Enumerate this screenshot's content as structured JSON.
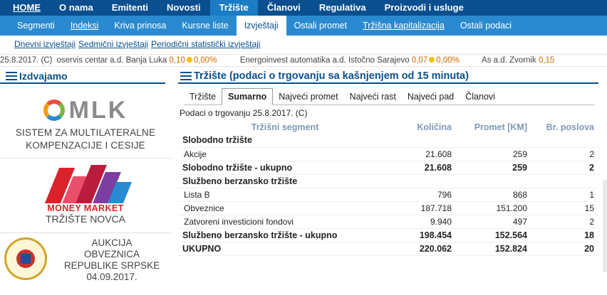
{
  "nav_main": [
    "HOME",
    "O nama",
    "Emitenti",
    "Novosti",
    "Tržište",
    "Članovi",
    "Regulativa",
    "Proizvodi i usluge"
  ],
  "nav_sub": [
    "Segmenti",
    "Indeksi",
    "Kriva prinosa",
    "Kursne liste",
    "Izvještaji",
    "Ostali promet",
    "Tržišna kapitalizacija",
    "Ostali podaci"
  ],
  "nav_reports": [
    "Dnevni izvještaji",
    "Sedmični izvještaji",
    "Periodični statistički izvještaji"
  ],
  "ticker": {
    "date": "25.8.2017. (C)",
    "items": [
      {
        "name": "oservis centar a.d. Banja Luka",
        "price": "0,10",
        "change": "0,00%"
      },
      {
        "name": "Energoinvest automatika a.d. Istočno Sarajevo",
        "price": "0,07",
        "change": "0,00%"
      },
      {
        "name": "As a.d. Zvornik",
        "price": "0,15",
        "change": ""
      }
    ]
  },
  "sidebar": {
    "title": "Izdvajamo",
    "mlk": {
      "logo": "MLK",
      "line1": "SISTEM ZA MULTILATERALNE",
      "line2": "KOMPENZACIJE I CESIJE"
    },
    "money_market": {
      "brand": "MONEY MARKET",
      "sub": "TRŽIŠTE NOVCA"
    },
    "auction": {
      "line1": "AUKCIJA",
      "line2": "OBVEZNICA",
      "line3": "REPUBLIKE SRPSKE",
      "line4": "04.09.2017."
    }
  },
  "main": {
    "title": "Tržište (podaci o trgovanju sa kašnjenjem od 15 minuta)",
    "tabs": [
      "Tržište",
      "Sumarno",
      "Najveći promet",
      "Najveći rast",
      "Najveći pad",
      "Članovi"
    ],
    "active_tab": "Sumarno",
    "caption": "Podaci o trgovanju 25.8.2017. (C)",
    "columns": [
      "Tržišni segment",
      "Količina",
      "Promet [KM]",
      "Br. poslova"
    ],
    "rows": [
      {
        "type": "section",
        "label": "Slobodno tržište"
      },
      {
        "type": "row",
        "label": "Akcije",
        "kolicina": "21.608",
        "promet": "259",
        "poslova": "2"
      },
      {
        "type": "total",
        "label": "Slobodno tržište - ukupno",
        "kolicina": "21.608",
        "promet": "259",
        "poslova": "2"
      },
      {
        "type": "section",
        "label": "Službeno berzansko tržište"
      },
      {
        "type": "row",
        "label": "Lista B",
        "kolicina": "796",
        "promet": "868",
        "poslova": "1"
      },
      {
        "type": "row",
        "label": "Obveznice",
        "kolicina": "187.718",
        "promet": "151.200",
        "poslova": "15"
      },
      {
        "type": "row",
        "label": "Zatvoreni investicioni fondovi",
        "kolicina": "9.940",
        "promet": "497",
        "poslova": "2"
      },
      {
        "type": "total",
        "label": "Službeno berzansko tržište - ukupno",
        "kolicina": "198.454",
        "promet": "152.564",
        "poslova": "18"
      },
      {
        "type": "total",
        "label": "UKUPNO",
        "kolicina": "220.062",
        "promet": "152.824",
        "poslova": "20"
      }
    ]
  },
  "colors": {
    "nav_dark": "#0a4f8f",
    "nav_light": "#2a8ad0",
    "accent_orange": "#d06a00",
    "header_col": "#7e98b8",
    "brand_red": "#d9222a"
  }
}
